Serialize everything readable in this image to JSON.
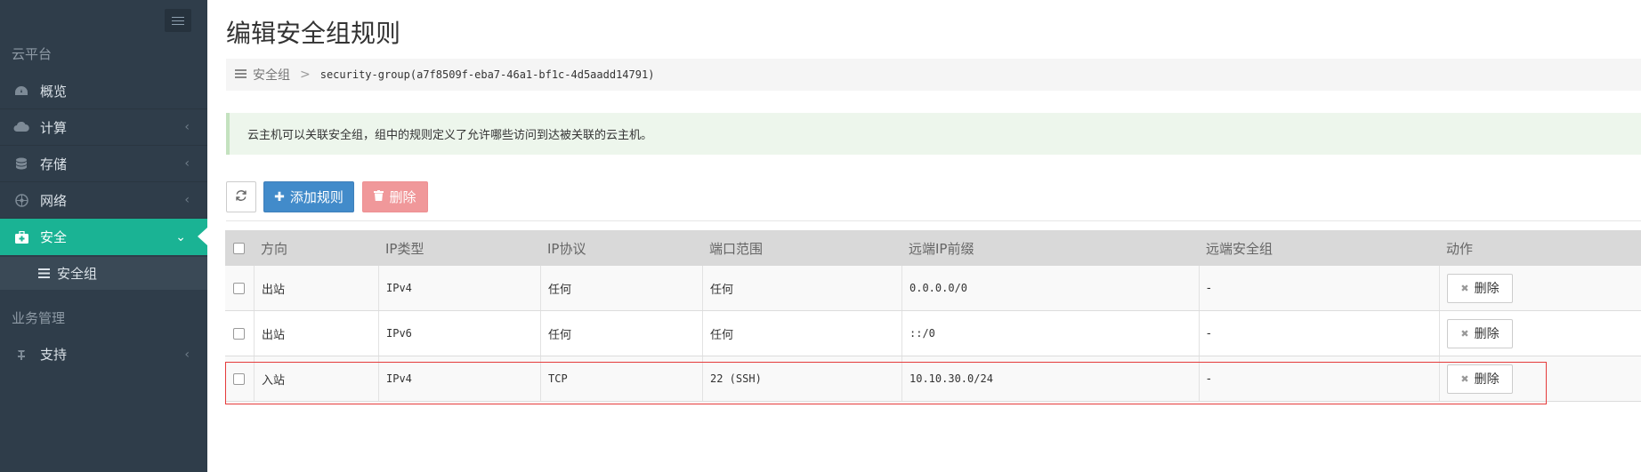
{
  "sidebar": {
    "section_cloud": "云平台",
    "items": [
      {
        "label": "概览",
        "icon": "dashboard-icon"
      },
      {
        "label": "计算",
        "icon": "cloud-icon"
      },
      {
        "label": "存储",
        "icon": "database-icon"
      },
      {
        "label": "网络",
        "icon": "network-icon"
      },
      {
        "label": "安全",
        "icon": "medkit-icon"
      }
    ],
    "sub_item": {
      "label": "安全组",
      "icon": "list-icon"
    },
    "section_business": "业务管理",
    "support": {
      "label": "支持",
      "icon": "anchor-icon"
    }
  },
  "page": {
    "title": "编辑安全组规则"
  },
  "breadcrumb": {
    "parent": "安全组",
    "separator": ">",
    "current": "security-group(a7f8509f-eba7-46a1-bf1c-4d5aadd14791)"
  },
  "alert": {
    "text": "云主机可以关联安全组，组中的规则定义了允许哪些访问到达被关联的云主机。"
  },
  "toolbar": {
    "add_label": "添加规则",
    "delete_label": "删除"
  },
  "table": {
    "headers": [
      "方向",
      "IP类型",
      "IP协议",
      "端口范围",
      "远端IP前缀",
      "远端安全组",
      "动作"
    ],
    "rows": [
      {
        "direction": "出站",
        "ip_type": "IPv4",
        "protocol": "任何",
        "port_range": "任何",
        "remote_ip": "0.0.0.0/0",
        "remote_group": "-",
        "action": "删除"
      },
      {
        "direction": "出站",
        "ip_type": "IPv6",
        "protocol": "任何",
        "port_range": "任何",
        "remote_ip": "::/0",
        "remote_group": "-",
        "action": "删除"
      },
      {
        "direction": "入站",
        "ip_type": "IPv4",
        "protocol": "TCP",
        "port_range": "22 (SSH)",
        "remote_ip": "10.10.30.0/24",
        "remote_group": "-",
        "action": "删除"
      }
    ]
  },
  "colors": {
    "sidebar_bg": "#2f3d4a",
    "active_bg": "#1ab394",
    "primary_button": "#428bca",
    "danger_button": "#f0989a",
    "highlight_border": "#e53b3b"
  }
}
